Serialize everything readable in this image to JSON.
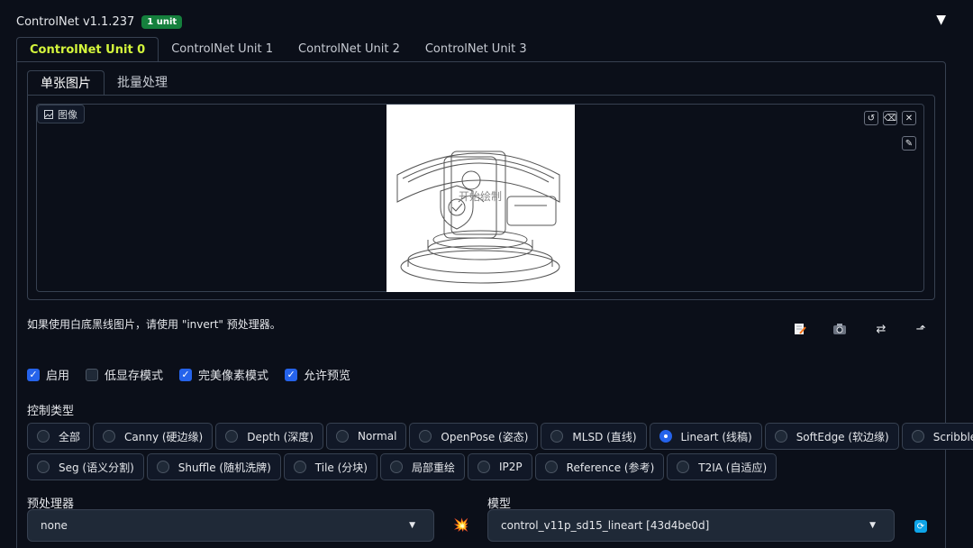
{
  "header": {
    "title": "ControlNet v1.1.237",
    "badge": "1 unit",
    "collapse_icon": "▼"
  },
  "unit_tabs": [
    "ControlNet Unit 0",
    "ControlNet Unit 1",
    "ControlNet Unit 2",
    "ControlNet Unit 3"
  ],
  "image_tabs": [
    "单张图片",
    "批量处理"
  ],
  "image_panel": {
    "label": "图像",
    "label_icon": "image-icon",
    "canvas_text": "开始绘制",
    "tools": [
      "undo-icon",
      "eraser-icon",
      "close-icon",
      "brush-icon"
    ]
  },
  "hint": "如果使用白底黑线图片，请使用 \"invert\" 预处理器。",
  "actions": [
    "edit-icon",
    "camera-icon",
    "swap-icon",
    "send-icon"
  ],
  "checkboxes": [
    {
      "label": "启用",
      "checked": true
    },
    {
      "label": "低显存模式",
      "checked": false
    },
    {
      "label": "完美像素模式",
      "checked": true
    },
    {
      "label": "允许预览",
      "checked": true
    }
  ],
  "control_type": {
    "label": "控制类型",
    "row1": [
      "全部",
      "Canny (硬边缘)",
      "Depth (深度)",
      "Normal",
      "OpenPose (姿态)",
      "MLSD (直线)",
      "Lineart (线稿)",
      "SoftEdge (软边缘)",
      "Scribble (涂鸦)"
    ],
    "row2": [
      "Seg (语义分割)",
      "Shuffle (随机洗牌)",
      "Tile (分块)",
      "局部重绘",
      "IP2P",
      "Reference (参考)",
      "T2IA (自适应)"
    ],
    "selected": "Lineart (线稿)"
  },
  "preprocessor": {
    "label": "预处理器",
    "value": "none"
  },
  "model": {
    "label": "模型",
    "value": "control_v11p_sd15_lineart [43d4be0d]"
  },
  "colors": {
    "accent_tab": "#d4f53c",
    "badge": "#15803d",
    "checkbox": "#2563eb",
    "background": "#0b0f19"
  }
}
